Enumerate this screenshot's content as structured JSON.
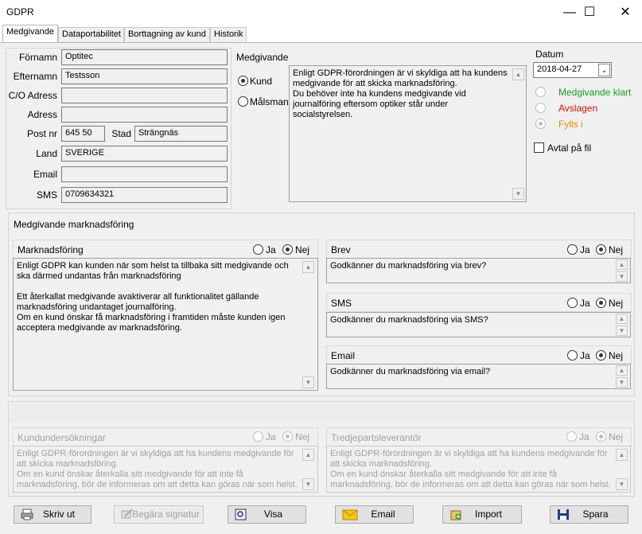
{
  "window": {
    "title": "GDPR",
    "minimize": "—",
    "maximize": "☐",
    "close": "✕"
  },
  "tabs": [
    "Medgivande",
    "Dataportabilitet",
    "Borttagning av kund",
    "Historik"
  ],
  "form": {
    "fornamn_label": "Förnamn",
    "fornamn": "Optitec",
    "efternamn_label": "Efternamn",
    "efternamn": "Testsson",
    "co_label": "C/O Adress",
    "co": "",
    "adress_label": "Adress",
    "adress": "",
    "postnr_label": "Post nr",
    "postnr": "645 50",
    "stad_label": "Stad",
    "stad": "Strängnäs",
    "land_label": "Land",
    "land": "SVERIGE",
    "email_label": "Email",
    "email": "",
    "sms_label": "SMS",
    "sms": "0709634321"
  },
  "medgivande": {
    "title": "Medgivande",
    "kund": "Kund",
    "malsman": "Målsman",
    "text": "Enligt GDPR-förordningen är vi skyldiga att ha kundens medgivande för att skicka marknadsföring.\nDu behöver inte ha kundens medgivande vid journalföring eftersom optiker står under socialstyrelsen."
  },
  "datum": {
    "label": "Datum",
    "value": "2018-04-27",
    "status_klart": "Medgivande klart",
    "status_avslagen": "Avslagen",
    "status_fylls": "Fylls i",
    "avtal": "Avtal på fil",
    "colors": {
      "klart": "#1a9e1a",
      "avslagen": "#d01010",
      "fylls": "#e08a00"
    }
  },
  "marknad": {
    "section_title": "Medgivande marknadsföring",
    "mf_title": "Marknadsföring",
    "mf_text": "Enligt GDPR kan kunden när som helst ta tillbaka sitt medgivande och ska därmed undantas från marknadsföring\n\nEtt återkallat medgivande avaktiverar all funktionalitet gällande marknadsföring undantaget journalföring.\nOm en kund önskar få marknadsföring i framtiden måste kunden igen acceptera medgivande av marknadsföring.",
    "ja": "Ja",
    "nej": "Nej",
    "brev_title": "Brev",
    "brev_text": "Godkänner du marknadsföring via brev?",
    "sms_title": "SMS",
    "sms_text": "Godkänner du marknadsföring via SMS?",
    "email_title": "Email",
    "email_text": "Godkänner du marknadsföring via email?"
  },
  "disabled": {
    "kund_title": "Kundundersökningar",
    "kund_text": "Enligt GDPR-förordningen är vi skyldiga att ha kundens medgivande för att skicka marknadsföring.\nOm en kund önskar återkalla sitt medgivande för att inte få marknadsföring, bör de informeras om att detta kan göras när som helst.",
    "tredje_title": "Tredjepartsleverantör",
    "tredje_text": "Enligt GDPR-förordningen är vi skyldiga att ha kundens medgivande för att skicka marknadsföring.\nOm en kund önskar återkalla sitt medgivande för att inte få marknadsföring, bör de informeras om att detta kan göras när som helst."
  },
  "buttons": {
    "print": "Skriv ut",
    "signature": "Begära signatur",
    "visa": "Visa",
    "email": "Email",
    "import": "Import",
    "spara": "Spara"
  }
}
